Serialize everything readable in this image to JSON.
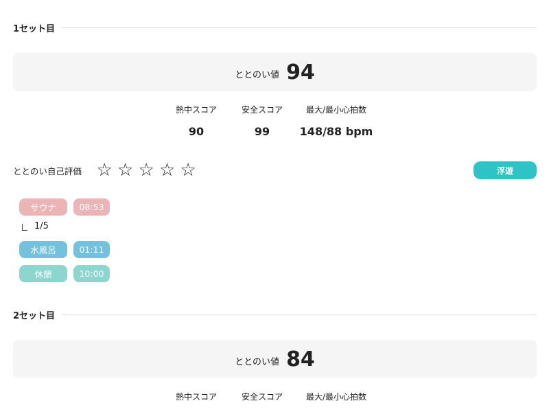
{
  "sets": [
    {
      "title": "1セット目",
      "totonoi_label": "ととのい値",
      "totonoi_value": "94",
      "stats": [
        {
          "label": "熱中スコア",
          "value": "90"
        },
        {
          "label": "安全スコア",
          "value": "99"
        },
        {
          "label": "最大/最小心拍数",
          "value": "148/88 bpm"
        }
      ],
      "self_eval_label": "ととのい自己評価",
      "stars": [
        "☆",
        "☆",
        "☆",
        "☆",
        "☆"
      ],
      "rating": 0,
      "mood": "浮遊",
      "steps": {
        "sauna": {
          "label": "サウナ",
          "time": "08:53"
        },
        "count": "1/5",
        "water": {
          "label": "水風呂",
          "time": "01:11"
        },
        "rest": {
          "label": "休憩",
          "time": "10:00"
        }
      }
    },
    {
      "title": "2セット目",
      "totonoi_label": "ととのい値",
      "totonoi_value": "84",
      "stats": [
        {
          "label": "熱中スコア"
        },
        {
          "label": "安全スコア"
        },
        {
          "label": "最大/最小心拍数"
        }
      ]
    }
  ],
  "colors": {
    "mood_chip": "#2ec4c6",
    "sauna": "#ebb5b5",
    "water": "#72c1df",
    "rest": "#8dd6cf",
    "score_box": "#f5f5f5"
  }
}
